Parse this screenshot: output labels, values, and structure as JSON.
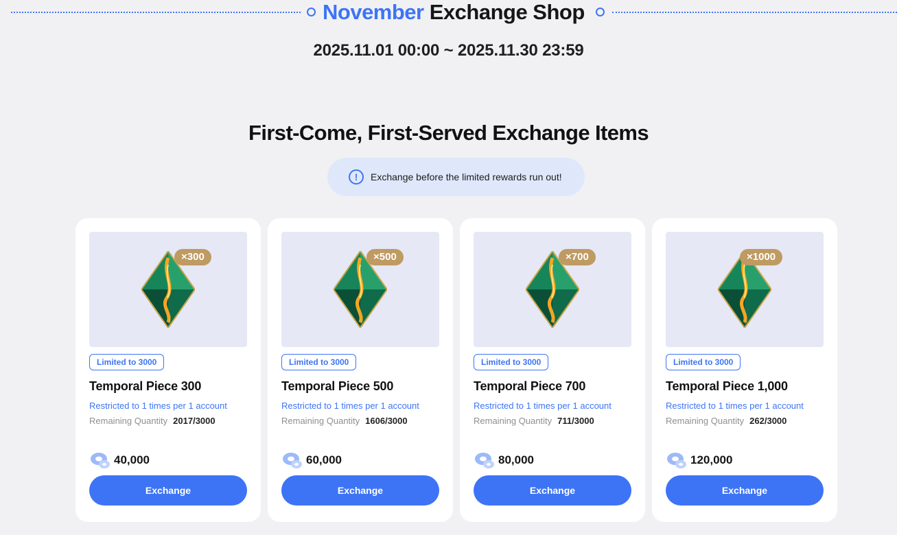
{
  "header": {
    "title_month": "November",
    "title_rest": "Exchange Shop",
    "period": "2025.11.01 00:00 ~ 2025.11.30 23:59"
  },
  "section": {
    "title": "First-Come, First-Served Exchange Items",
    "notice": "Exchange before the limited rewards run out!",
    "notice_icon": "info-circle-icon"
  },
  "items": [
    {
      "qty_badge": "×300",
      "limit_tag": "Limited to 3000",
      "name": "Temporal Piece 300",
      "restriction": "Restricted to 1 times per 1 account",
      "remaining_label": "Remaining Quantity",
      "remaining": "2017/3000",
      "price": "40,000",
      "button": "Exchange"
    },
    {
      "qty_badge": "×500",
      "limit_tag": "Limited to 3000",
      "name": "Temporal Piece 500",
      "restriction": "Restricted to 1 times per 1 account",
      "remaining_label": "Remaining Quantity",
      "remaining": "1606/3000",
      "price": "60,000",
      "button": "Exchange"
    },
    {
      "qty_badge": "×700",
      "limit_tag": "Limited to 3000",
      "name": "Temporal Piece 700",
      "restriction": "Restricted to 1 times per 1 account",
      "remaining_label": "Remaining Quantity",
      "remaining": "711/3000",
      "price": "80,000",
      "button": "Exchange"
    },
    {
      "qty_badge": "×1000",
      "limit_tag": "Limited to 3000",
      "name": "Temporal Piece 1,000",
      "restriction": "Restricted to 1 times per 1 account",
      "remaining_label": "Remaining Quantity",
      "remaining": "262/3000",
      "price": "120,000",
      "button": "Exchange"
    }
  ],
  "colors": {
    "accent": "#3d74f5",
    "badge": "#bf9a62",
    "background": "#f1f1f4",
    "thumb_bg": "#e6e8f5",
    "notice_bg": "#dfe8fb"
  },
  "icons": {
    "item": "green-crystal-icon",
    "currency": "blue-ring-currency-icon"
  }
}
